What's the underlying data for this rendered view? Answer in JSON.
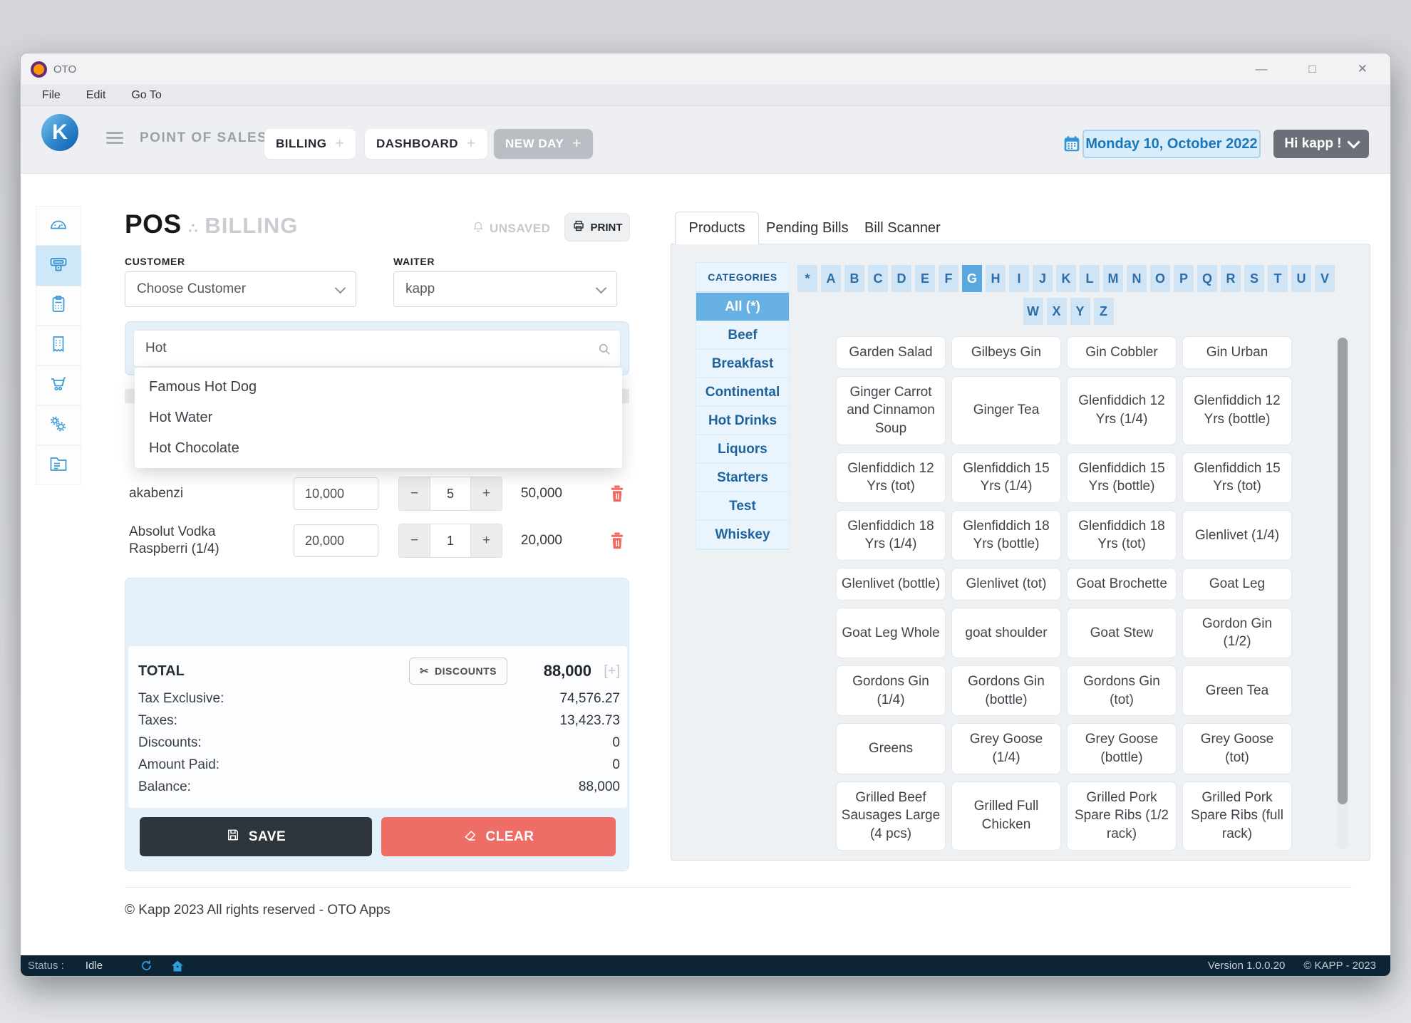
{
  "window": {
    "title": "OTO",
    "menu": [
      "File",
      "Edit",
      "Go To"
    ],
    "controls": {
      "minimize": "—",
      "maximize": "□",
      "close": "✕"
    }
  },
  "header": {
    "logo_letter": "K",
    "app_title": "POINT OF SALES",
    "tabs": [
      {
        "label": "BILLING"
      },
      {
        "label": "DASHBOARD"
      }
    ],
    "new_day_label": "NEW DAY",
    "plus_glyph": "+",
    "date": "Monday 10, October 2022",
    "user_label": "Hi kapp !"
  },
  "sidebar": {
    "icons": [
      "dashboard-gauge",
      "billing-register",
      "order-pad",
      "receipt",
      "cart",
      "settings-gears",
      "documents-folder"
    ],
    "active_icon": "billing-register"
  },
  "billing": {
    "title_pos": "POS",
    "title_separator": "∴",
    "title_section": "BILLING",
    "unsaved_label": "UNSAVED",
    "print_label": "PRINT",
    "customer_label": "CUSTOMER",
    "customer_value": "Choose Customer",
    "waiter_label": "WAITER",
    "waiter_value": "kapp",
    "search_value": "Hot",
    "suggestions": [
      "Famous Hot Dog",
      "Hot Water",
      "Hot Chocolate"
    ],
    "stepper": {
      "minus": "−",
      "plus": "+"
    },
    "items": [
      {
        "name": "akabenzi",
        "price": "10,000",
        "qty": "5",
        "amount": "50,000"
      },
      {
        "name": "Absolut Vodka Raspberri (1/4)",
        "price": "20,000",
        "qty": "1",
        "amount": "20,000"
      }
    ],
    "totals": {
      "total_label": "TOTAL",
      "discounts_label": "DISCOUNTS",
      "discounts_icon": "✂",
      "total_value": "88,000",
      "total_plus": "[+]",
      "rows": [
        {
          "label": "Tax Exclusive:",
          "value": "74,576.27"
        },
        {
          "label": "Taxes:",
          "value": "13,423.73"
        },
        {
          "label": "Discounts:",
          "value": "0"
        },
        {
          "label": "Amount Paid:",
          "value": "0"
        },
        {
          "label": "Balance:",
          "value": "88,000"
        }
      ]
    },
    "save_label": "SAVE",
    "clear_label": "CLEAR",
    "footer": "© Kapp 2023 All rights reserved - OTO Apps"
  },
  "products_panel": {
    "tabs": [
      "Products",
      "Pending Bills",
      "Bill Scanner"
    ],
    "active_tab": "Products",
    "categories_label": "CATEGORIES",
    "categories": [
      "All (*)",
      "Beef",
      "Breakfast",
      "Continental",
      "Hot Drinks",
      "Liquors",
      "Starters",
      "Test",
      "Whiskey"
    ],
    "active_category": "All (*)",
    "alphabet_row1": [
      "*",
      "A",
      "B",
      "C",
      "D",
      "E",
      "F",
      "G",
      "H",
      "I",
      "J",
      "K",
      "L",
      "M",
      "N",
      "O",
      "P",
      "Q",
      "R",
      "S",
      "T",
      "U",
      "V"
    ],
    "alphabet_row2": [
      "W",
      "X",
      "Y",
      "Z"
    ],
    "active_letter": "G",
    "products": [
      "Garden Salad",
      "Gilbeys Gin",
      "Gin Cobbler",
      "Gin Urban",
      "Ginger Carrot and Cinnamon Soup",
      "Ginger Tea",
      "Glenfiddich 12 Yrs (1/4)",
      "Glenfiddich 12 Yrs (bottle)",
      "Glenfiddich 12 Yrs (tot)",
      "Glenfiddich 15 Yrs (1/4)",
      "Glenfiddich 15 Yrs (bottle)",
      "Glenfiddich 15 Yrs (tot)",
      "Glenfiddich 18 Yrs (1/4)",
      "Glenfiddich 18 Yrs (bottle)",
      "Glenfiddich 18 Yrs (tot)",
      "Glenlivet (1/4)",
      "Glenlivet (bottle)",
      "Glenlivet (tot)",
      "Goat Brochette",
      "Goat Leg",
      "Goat Leg Whole",
      "goat shoulder",
      "Goat Stew",
      "Gordon Gin (1/2)",
      "Gordons Gin (1/4)",
      "Gordons Gin (bottle)",
      "Gordons Gin (tot)",
      "Green Tea",
      "Greens",
      "Grey Goose (1/4)",
      "Grey Goose (bottle)",
      "Grey Goose (tot)",
      "Grilled Beef Sausages Large (4 pcs)",
      "Grilled Full Chicken",
      "Grilled Pork Spare Ribs (1/2 rack)",
      "Grilled Pork Spare Ribs (full rack)"
    ]
  },
  "status_bar": {
    "status_label": "Status :",
    "status_value": "Idle",
    "version": "Version 1.0.0.20",
    "copyright": "© KAPP - 2023"
  },
  "colors": {
    "accent_blue": "#3598d4",
    "date_text": "#1878bb",
    "active_category_bg": "#66b0e3",
    "danger_red": "#ee6e67",
    "save_dark": "#2e353d",
    "statusbar_bg": "#0d2434",
    "panel_light_blue": "#e4f1fb"
  }
}
